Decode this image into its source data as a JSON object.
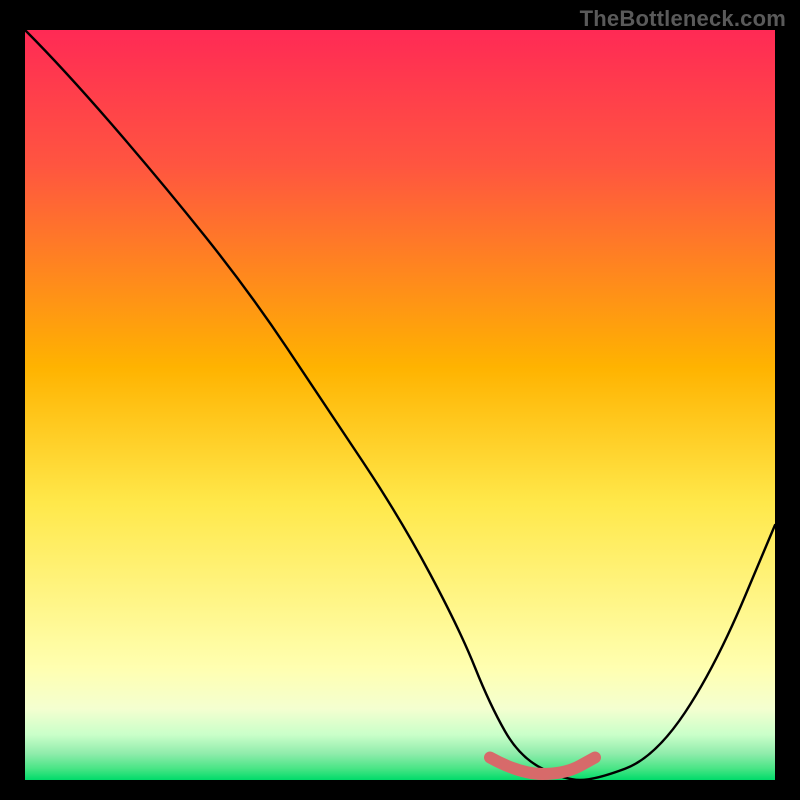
{
  "watermark": "TheBottleneck.com",
  "chart_data": {
    "type": "line",
    "title": "",
    "xlabel": "",
    "ylabel": "",
    "xlim": [
      0,
      100
    ],
    "ylim": [
      0,
      100
    ],
    "grid": false,
    "legend": false,
    "background": {
      "bands": [
        {
          "y0": 100,
          "y1": 40,
          "gradient_from": "#ff2a4b",
          "gradient_to": "#ffd400"
        },
        {
          "y0": 40,
          "y1": 10,
          "gradient_from": "#ffd400",
          "gradient_to": "#ffff8a"
        },
        {
          "y0": 10,
          "y1": 4,
          "gradient_from": "#ffff8a",
          "gradient_to": "#ccffcc"
        },
        {
          "y0": 4,
          "y1": 0,
          "gradient_from": "#ccffcc",
          "gradient_to": "#00e06b"
        }
      ]
    },
    "series": [
      {
        "name": "bottleneck-curve",
        "color": "#000000",
        "x": [
          0,
          5,
          18,
          30,
          40,
          50,
          58,
          62,
          66,
          72,
          76,
          84,
          92,
          100
        ],
        "y": [
          100,
          95,
          80,
          65,
          50,
          35,
          20,
          10,
          3,
          0,
          0,
          3,
          15,
          34
        ]
      }
    ],
    "highlight": {
      "name": "optimal-range",
      "color": "#d76a6a",
      "x": [
        62,
        66,
        72,
        76
      ],
      "y": [
        3,
        0.8,
        0.8,
        3
      ]
    }
  }
}
